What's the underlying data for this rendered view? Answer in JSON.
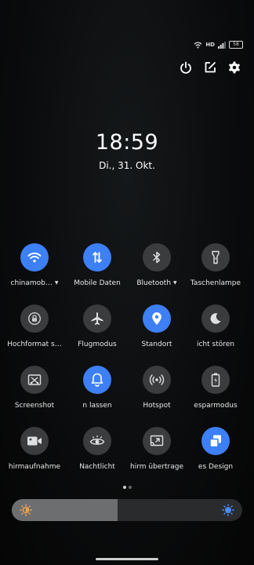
{
  "status": {
    "hd": "HD",
    "battery": "58"
  },
  "clock": {
    "time": "18:59",
    "date": "Di., 31. Okt."
  },
  "tiles": [
    {
      "label": "chinamob…",
      "on": true,
      "icon": "wifi-icon",
      "caret": true
    },
    {
      "label": "Mobile Daten",
      "on": true,
      "icon": "mobile-data-icon",
      "caret": false
    },
    {
      "label": "Bluetooth",
      "on": false,
      "icon": "bluetooth-icon",
      "caret": true
    },
    {
      "label": "Taschenlampe",
      "on": false,
      "icon": "flashlight-icon",
      "caret": false
    },
    {
      "label": "Hochformat s…",
      "on": false,
      "icon": "rotation-lock-icon",
      "caret": false
    },
    {
      "label": "Flugmodus",
      "on": false,
      "icon": "airplane-icon",
      "caret": false
    },
    {
      "label": "Standort",
      "on": true,
      "icon": "location-icon",
      "caret": false
    },
    {
      "label": "icht stören",
      "on": false,
      "icon": "moon-icon",
      "caret": false
    },
    {
      "label": "Screenshot",
      "on": false,
      "icon": "screenshot-icon",
      "caret": false
    },
    {
      "label": "n lassen",
      "on": true,
      "icon": "bell-icon",
      "caret": false
    },
    {
      "label": "Hotspot",
      "on": false,
      "icon": "hotspot-icon",
      "caret": false
    },
    {
      "label": "esparmodus",
      "on": false,
      "icon": "battery-saver-icon",
      "caret": false
    },
    {
      "label": "hirmaufnahme",
      "on": false,
      "icon": "screen-record-icon",
      "caret": false
    },
    {
      "label": "Nachtlicht",
      "on": false,
      "icon": "eye-icon",
      "caret": false
    },
    {
      "label": "hirm übertrage",
      "on": false,
      "icon": "cast-icon",
      "caret": false
    },
    {
      "label": "es Design",
      "on": true,
      "icon": "design-icon",
      "caret": false
    }
  ],
  "brightness": {
    "level": 0.46
  },
  "colors": {
    "accent": "#3d7ff5",
    "tile_off": "#3a3c3e",
    "sun_left": "#f0a050",
    "sun_right": "#4a8cf5"
  }
}
